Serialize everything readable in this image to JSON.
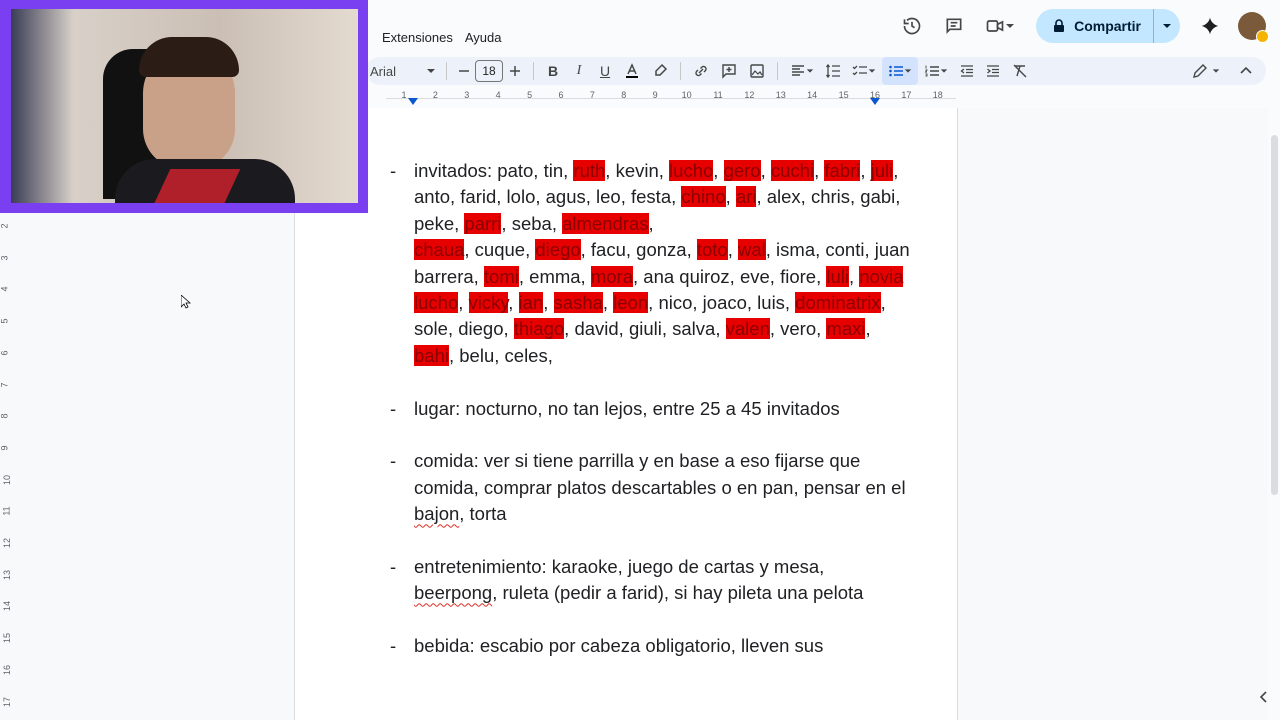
{
  "menu": {
    "extensions": "Extensiones",
    "help": "Ayuda"
  },
  "header": {
    "share_label": "Compartir"
  },
  "toolbar": {
    "font": "Arial",
    "font_size": "18"
  },
  "ruler": {
    "numbers": [
      "1",
      "2",
      "3",
      "4",
      "5",
      "6",
      "7",
      "8",
      "9",
      "10",
      "11",
      "12",
      "13",
      "14",
      "15",
      "16",
      "17",
      "18"
    ]
  },
  "vruler": {
    "numbers": [
      "2",
      "3",
      "4",
      "5",
      "6",
      "7",
      "8",
      "9",
      "10",
      "11",
      "12",
      "13",
      "14",
      "15",
      "16",
      "17"
    ]
  },
  "doc": {
    "dash": "-",
    "invitados": {
      "s0": "invitados: pato, tin, ",
      "h1": "ruth",
      "s1": ", kevin, ",
      "h2": "lucho",
      "s2": ", ",
      "h3": "gero",
      "s3": ", ",
      "h4": "cuchi",
      "s4": ", ",
      "h5": "fabri",
      "s5": ", ",
      "h6": "juli",
      "s6": ", anto, farid, lolo, agus, leo, festa, ",
      "h7": "chino",
      "s7": ", ",
      "h8": "ari",
      "s8": ",",
      "s9": " alex, chris, gabi, peke, ",
      "h9": "parri",
      "s10": ", seba, ",
      "h10": "almendras",
      "s11": ",",
      "h11": "chaua",
      "s12": ", cuque, ",
      "h12": "diego",
      "s13": ", facu, gonza, ",
      "h13": "toto",
      "s14": ", ",
      "h14": "wal",
      "s15": ", isma,",
      "s16": " conti, juan barrera, ",
      "h15": "tomi",
      "s17": ", emma, ",
      "h16": "mora",
      "s18": ", ana quiroz,",
      "s19": " eve, fiore, ",
      "h17": "luli",
      "s20": ", ",
      "h18": "novia lucho",
      "s21": ", ",
      "h19": "vicky",
      "s22": ", ",
      "h20": "ian",
      "s23": ", ",
      "h21": "sasha",
      "s24": ", ",
      "h22": "leon",
      "s25": ",",
      "s26": " nico, joaco, luis, ",
      "h23": "dominatrix",
      "s27": ", sole, diego, ",
      "h24": "thiago",
      "s28": ",",
      "s29": " david, giuli, salva, ",
      "h25": "valen",
      "s30": ", vero, ",
      "h26": "maxi",
      "s31": ", ",
      "h27": "bahi",
      "s32": ", belu,",
      "s33": " celes,"
    },
    "lugar": "lugar: nocturno, no tan lejos, entre 25 a 45 invitados",
    "comida": {
      "s0": "comida: ver si tiene parrilla y en base a eso fijarse que comida, comprar platos descartables o en pan, pensar en el ",
      "sq": "bajon",
      "s1": ", torta"
    },
    "entretenimiento": {
      "s0": "entretenimiento: karaoke, juego de cartas y mesa, ",
      "sq": "beerpong",
      "s1": ", ruleta (pedir a farid), si hay pileta una pelota"
    },
    "bebida": "bebida: escabio por cabeza obligatorio, lleven sus"
  },
  "colors": {
    "highlight": "#e60000",
    "share_bg": "#c2e7ff",
    "webcam_border": "#7b3ff2"
  }
}
